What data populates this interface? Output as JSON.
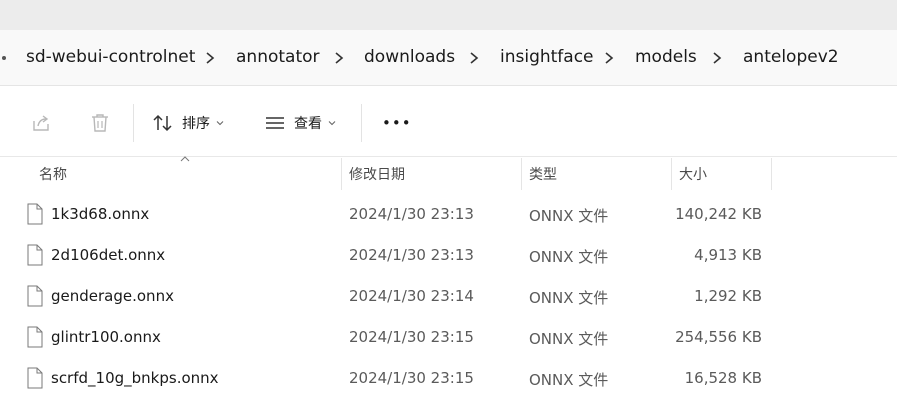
{
  "breadcrumb": {
    "items": [
      "sd-webui-controlnet",
      "annotator",
      "downloads",
      "insightface",
      "models",
      "antelopev2"
    ]
  },
  "toolbar": {
    "sort_label": "排序",
    "view_label": "查看",
    "more_label": "•••"
  },
  "columns": {
    "name": "名称",
    "date": "修改日期",
    "type": "类型",
    "size": "大小"
  },
  "files": [
    {
      "name": "1k3d68.onnx",
      "date": "2024/1/30 23:13",
      "type": "ONNX 文件",
      "size": "140,242 KB"
    },
    {
      "name": "2d106det.onnx",
      "date": "2024/1/30 23:13",
      "type": "ONNX 文件",
      "size": "4,913 KB"
    },
    {
      "name": "genderage.onnx",
      "date": "2024/1/30 23:14",
      "type": "ONNX 文件",
      "size": "1,292 KB"
    },
    {
      "name": "glintr100.onnx",
      "date": "2024/1/30 23:15",
      "type": "ONNX 文件",
      "size": "254,556 KB"
    },
    {
      "name": "scrfd_10g_bnkps.onnx",
      "date": "2024/1/30 23:15",
      "type": "ONNX 文件",
      "size": "16,528 KB"
    }
  ],
  "icons": {
    "share": "share-icon",
    "delete": "trash-icon",
    "sort": "sort-arrows-icon",
    "view": "list-view-icon",
    "file": "file-icon",
    "chevron": "chevron-right-icon"
  }
}
